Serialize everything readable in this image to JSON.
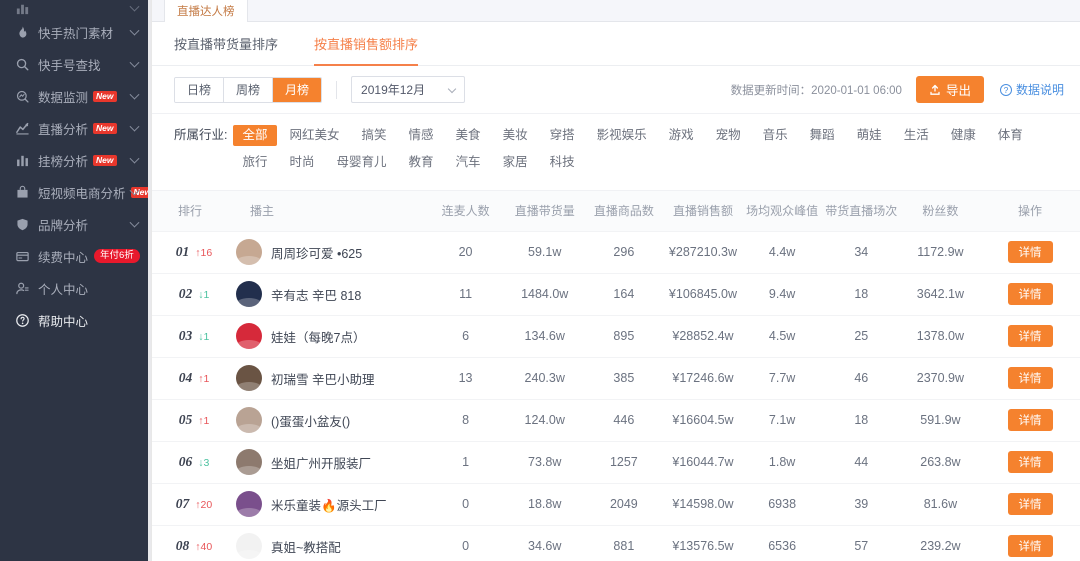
{
  "sidebar": {
    "items": [
      {
        "label": "",
        "icon": "chart-icon",
        "cutoff": true,
        "chevron": true,
        "badge": ""
      },
      {
        "label": "快手热门素材",
        "icon": "fire-icon",
        "chevron": true,
        "badge": ""
      },
      {
        "label": "快手号查找",
        "icon": "search-icon",
        "chevron": true,
        "badge": ""
      },
      {
        "label": "数据监测",
        "icon": "monitor-icon",
        "chevron": true,
        "badge": "New"
      },
      {
        "label": "直播分析",
        "icon": "trend-icon",
        "chevron": true,
        "badge": "New"
      },
      {
        "label": "挂榜分析",
        "icon": "bars-icon",
        "chevron": true,
        "badge": "New"
      },
      {
        "label": "短视频电商分析",
        "icon": "bag-icon",
        "chevron": true,
        "badge": "New"
      },
      {
        "label": "品牌分析",
        "icon": "shield-icon",
        "chevron": true,
        "badge": ""
      },
      {
        "label": "续费中心",
        "icon": "card-icon",
        "chevron": false,
        "pill": "年付6折"
      },
      {
        "label": "个人中心",
        "icon": "user-icon",
        "chevron": false,
        "badge": ""
      },
      {
        "label": "帮助中心",
        "icon": "help-icon",
        "chevron": false,
        "badge": ""
      }
    ]
  },
  "tabs": [
    {
      "label": "直播达人榜",
      "active": true
    }
  ],
  "subtabs": [
    {
      "label": "按直播带货量排序",
      "active": false
    },
    {
      "label": "按直播销售额排序",
      "active": true
    }
  ],
  "filters": {
    "period_options": [
      {
        "label": "日榜",
        "active": false
      },
      {
        "label": "周榜",
        "active": false
      },
      {
        "label": "月榜",
        "active": true
      }
    ],
    "month_select": {
      "value": "2019年12月"
    },
    "update_time": "数据更新时间：2020-01-01 06:00",
    "export_label": "导出",
    "help_label": "数据说明"
  },
  "industry": {
    "label": "所属行业:",
    "tags": [
      {
        "label": "全部",
        "active": true
      },
      {
        "label": "网红美女",
        "active": false
      },
      {
        "label": "搞笑",
        "active": false
      },
      {
        "label": "情感",
        "active": false
      },
      {
        "label": "美食",
        "active": false
      },
      {
        "label": "美妆",
        "active": false
      },
      {
        "label": "穿搭",
        "active": false
      },
      {
        "label": "影视娱乐",
        "active": false
      },
      {
        "label": "游戏",
        "active": false
      },
      {
        "label": "宠物",
        "active": false
      },
      {
        "label": "音乐",
        "active": false
      },
      {
        "label": "舞蹈",
        "active": false
      },
      {
        "label": "萌娃",
        "active": false
      },
      {
        "label": "生活",
        "active": false
      },
      {
        "label": "健康",
        "active": false
      },
      {
        "label": "体育",
        "active": false
      },
      {
        "label": "旅行",
        "active": false
      },
      {
        "label": "时尚",
        "active": false
      },
      {
        "label": "母婴育儿",
        "active": false
      },
      {
        "label": "教育",
        "active": false
      },
      {
        "label": "汽车",
        "active": false
      },
      {
        "label": "家居",
        "active": false
      },
      {
        "label": "科技",
        "active": false
      }
    ]
  },
  "table": {
    "columns": [
      "排行",
      "播主",
      "连麦人数",
      "直播带货量",
      "直播商品数",
      "直播销售额",
      "场均观众峰值",
      "带货直播场次",
      "粉丝数",
      "操作"
    ],
    "action_label": "详情",
    "rows": [
      {
        "rank": "01",
        "delta": "16",
        "delta_dir": "up",
        "avatar_color": "#c6a892",
        "name": "周周珍可爱 •625",
        "mic_count": "20",
        "live_volume": "59.1w",
        "goods_count": "296",
        "sales": "¥287210.3w",
        "avg_peak": "4.4w",
        "live_sessions": "34",
        "fans": "1172.9w"
      },
      {
        "rank": "02",
        "delta": "1",
        "delta_dir": "down",
        "avatar_color": "#222f4d",
        "name": "辛有志 辛巴 818",
        "mic_count": "11",
        "live_volume": "1484.0w",
        "goods_count": "164",
        "sales": "¥106845.0w",
        "avg_peak": "9.4w",
        "live_sessions": "18",
        "fans": "3642.1w"
      },
      {
        "rank": "03",
        "delta": "1",
        "delta_dir": "down",
        "avatar_color": "#d6293a",
        "name": "娃娃（每晚7点）",
        "mic_count": "6",
        "live_volume": "134.6w",
        "goods_count": "895",
        "sales": "¥28852.4w",
        "avg_peak": "4.5w",
        "live_sessions": "25",
        "fans": "1378.0w"
      },
      {
        "rank": "04",
        "delta": "1",
        "delta_dir": "up",
        "avatar_color": "#6a5444",
        "name": "初瑞雪 辛巴小助理",
        "mic_count": "13",
        "live_volume": "240.3w",
        "goods_count": "385",
        "sales": "¥17246.6w",
        "avg_peak": "7.7w",
        "live_sessions": "46",
        "fans": "2370.9w"
      },
      {
        "rank": "05",
        "delta": "1",
        "delta_dir": "up",
        "avatar_color": "#b9a394",
        "name": "()蛋蛋小盆友()",
        "mic_count": "8",
        "live_volume": "124.0w",
        "goods_count": "446",
        "sales": "¥16604.5w",
        "avg_peak": "7.1w",
        "live_sessions": "18",
        "fans": "591.9w"
      },
      {
        "rank": "06",
        "delta": "3",
        "delta_dir": "down",
        "avatar_color": "#8d7a6e",
        "name": "坐姐广州开服装厂",
        "mic_count": "1",
        "live_volume": "73.8w",
        "goods_count": "1257",
        "sales": "¥16044.7w",
        "avg_peak": "1.8w",
        "live_sessions": "44",
        "fans": "263.8w"
      },
      {
        "rank": "07",
        "delta": "20",
        "delta_dir": "up",
        "avatar_color": "#7a4f8c",
        "name": "米乐童装🔥源头工厂",
        "mic_count": "0",
        "live_volume": "18.8w",
        "goods_count": "2049",
        "sales": "¥14598.0w",
        "avg_peak": "6938",
        "live_sessions": "39",
        "fans": "81.6w"
      },
      {
        "rank": "08",
        "delta": "40",
        "delta_dir": "up",
        "avatar_color": "#f2f2f2",
        "name": "真姐~教搭配",
        "mic_count": "0",
        "live_volume": "34.6w",
        "goods_count": "881",
        "sales": "¥13576.5w",
        "avg_peak": "6536",
        "live_sessions": "57",
        "fans": "239.2w"
      }
    ]
  },
  "colors": {
    "accent": "#f5822e",
    "sidebar_bg": "#2d3444",
    "badge_red": "#e8372c",
    "up": "#e8565a",
    "down": "#4cc2a0"
  }
}
